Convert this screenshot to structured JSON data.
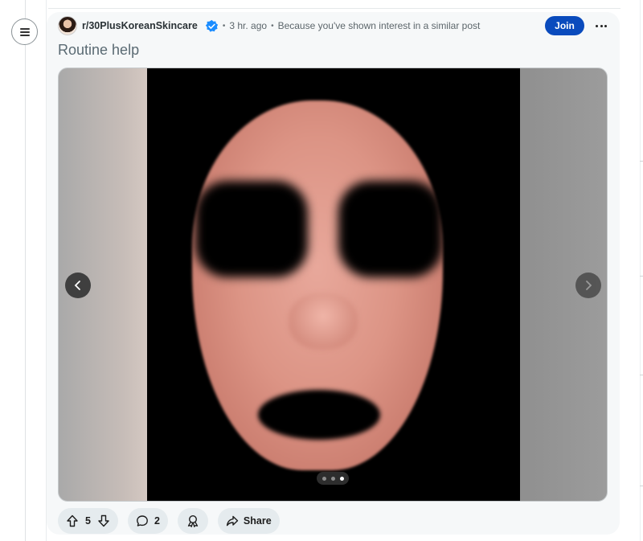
{
  "post": {
    "subreddit": "r/30PlusKoreanSkincare",
    "time": "3 hr. ago",
    "reason": "Because you've shown interest in a similar post",
    "join_label": "Join",
    "title": "Routine help",
    "gallery": {
      "current": 3,
      "total": 3
    },
    "actions": {
      "votes": "5",
      "comments": "2",
      "share_label": "Share"
    }
  },
  "icons": {
    "menu": "menu-icon",
    "verified": "verified-badge-icon",
    "more": "more-options-icon",
    "upvote": "upvote-icon",
    "downvote": "downvote-icon",
    "comment": "comment-icon",
    "award": "award-icon",
    "share": "share-icon",
    "prev": "chevron-left-icon",
    "next": "chevron-right-icon"
  },
  "colors": {
    "accent": "#0a4bbd",
    "card_bg": "#f6f8f9",
    "pill_bg": "#e5ebee",
    "verified": "#1a8cff"
  }
}
